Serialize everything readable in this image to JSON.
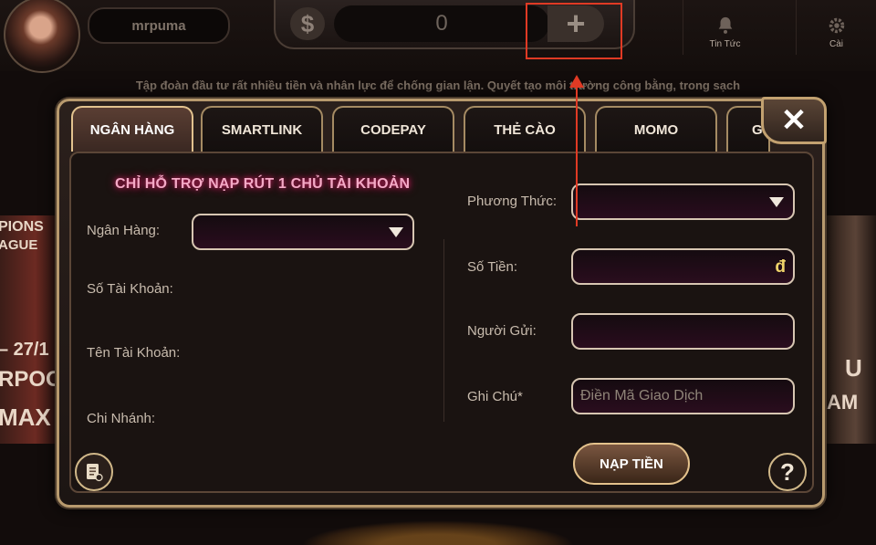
{
  "header": {
    "username": "mrpuma",
    "currency_symbol": "$",
    "balance": "0",
    "add_funds": "+",
    "news_label": "Tin Tức",
    "settings_label": "Cài"
  },
  "marquee": "Tập đoàn đầu tư rất nhiều tiền và nhân lực để chống gian lận. Quyết tạo môi trường công bằng, trong sạch",
  "side_banners": {
    "left_lines": [
      "PIONS",
      "AGUE",
      "– 27/1",
      "RPOO",
      "MAX"
    ],
    "right_lines": [
      "U",
      "AM"
    ]
  },
  "tabs": [
    {
      "label": "NGÂN HÀNG",
      "active": true
    },
    {
      "label": "SMARTLINK",
      "active": false
    },
    {
      "label": "CODEPAY",
      "active": false
    },
    {
      "label": "THẺ CÀO",
      "active": false
    },
    {
      "label": "MOMO",
      "active": false
    },
    {
      "label": "G",
      "active": false
    }
  ],
  "close_label": "✕",
  "form": {
    "notice": "CHỈ HỖ TRỢ NẠP RÚT 1 CHỦ TÀI KHOẢN",
    "bank_label": "Ngân Hàng:",
    "account_number_label": "Số Tài Khoản:",
    "account_name_label": "Tên Tài Khoản:",
    "branch_label": "Chi Nhánh:",
    "method_label": "Phương Thức:",
    "amount_label": "Số Tiền:",
    "amount_currency": "đ",
    "sender_label": "Người Gửi:",
    "note_label": "Ghi Chú*",
    "note_placeholder": "Điền Mã Giao Dịch",
    "submit_label": "NẠP TIỀN",
    "help_label": "?"
  },
  "colors": {
    "accent_gold": "#b89a6e",
    "notice_pink": "#f4a9c6",
    "annotation_red": "#e03a24"
  }
}
